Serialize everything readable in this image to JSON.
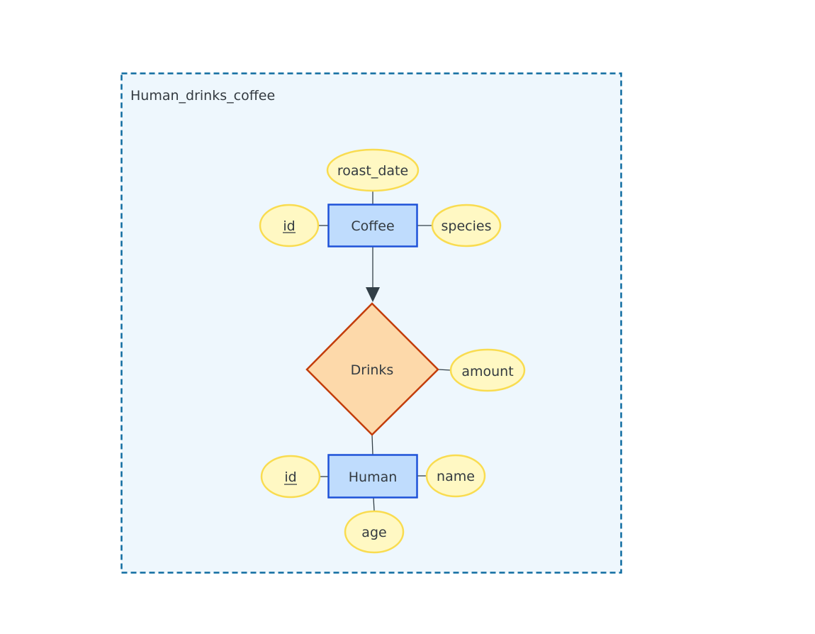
{
  "group": {
    "title": "Human_drinks_coffee",
    "border_color": "#0e6ba0",
    "fill": "#eef7fd"
  },
  "colors": {
    "entity_fill": "#bfdcfd",
    "entity_stroke": "#1e52d8",
    "attr_fill": "#fff8c3",
    "attr_stroke": "#f9dc50",
    "rel_fill": "#fdd9aa",
    "rel_stroke": "#c33d0b",
    "edge": "#323f47"
  },
  "entities": [
    {
      "id": "coffee",
      "label": "Coffee"
    },
    {
      "id": "human",
      "label": "Human"
    }
  ],
  "relationships": [
    {
      "id": "drinks",
      "label": "Drinks"
    }
  ],
  "attributes": [
    {
      "id": "coffee_roast_date",
      "owner": "coffee",
      "label": "roast_date",
      "key": false
    },
    {
      "id": "coffee_id",
      "owner": "coffee",
      "label": "id",
      "key": true
    },
    {
      "id": "coffee_species",
      "owner": "coffee",
      "label": "species",
      "key": false
    },
    {
      "id": "drinks_amount",
      "owner": "drinks",
      "label": "amount",
      "key": false
    },
    {
      "id": "human_id",
      "owner": "human",
      "label": "id",
      "key": true
    },
    {
      "id": "human_name",
      "owner": "human",
      "label": "name",
      "key": false
    },
    {
      "id": "human_age",
      "owner": "human",
      "label": "age",
      "key": false
    }
  ],
  "edges": [
    {
      "from": "coffee",
      "to": "drinks",
      "arrow": true
    },
    {
      "from": "drinks",
      "to": "human",
      "arrow": false
    }
  ]
}
